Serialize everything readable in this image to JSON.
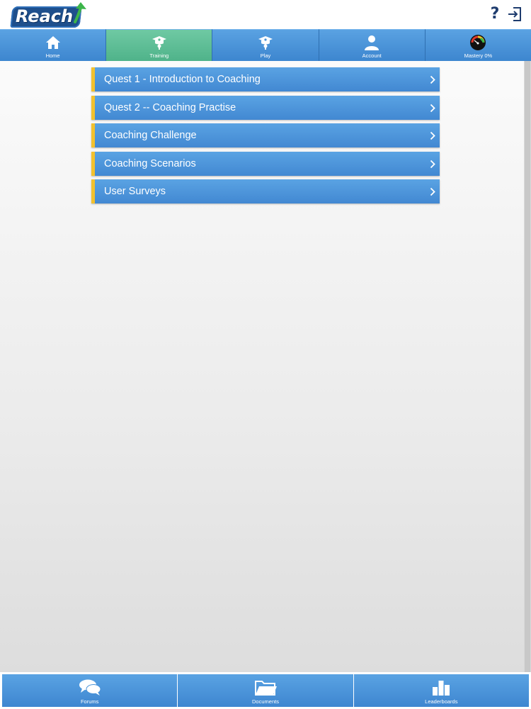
{
  "app": {
    "logo_text": "Reach"
  },
  "header": {
    "help_glyph": "?",
    "help_icon": "question-mark-icon",
    "logout_icon": "logout-icon"
  },
  "topnav": {
    "items": [
      {
        "label": "Home",
        "icon": "home-icon",
        "active": false
      },
      {
        "label": "Training",
        "icon": "graduation-icon",
        "active": true
      },
      {
        "label": "Play",
        "icon": "graduation-icon",
        "active": false
      },
      {
        "label": "Account",
        "icon": "user-icon",
        "active": false
      },
      {
        "label": "Mastery 0%",
        "icon": "gauge-icon",
        "active": false
      }
    ]
  },
  "menu": {
    "items": [
      {
        "label": "Quest 1 - Introduction to Coaching"
      },
      {
        "label": "Quest 2 -- Coaching Practise"
      },
      {
        "label": "Coaching Challenge"
      },
      {
        "label": "Coaching Scenarios"
      },
      {
        "label": "User Surveys"
      }
    ]
  },
  "bottomnav": {
    "items": [
      {
        "label": "Forums",
        "icon": "chat-bubbles-icon"
      },
      {
        "label": "Documents",
        "icon": "folder-icon"
      },
      {
        "label": "Leaderboards",
        "icon": "bar-chart-icon"
      }
    ]
  },
  "colors": {
    "nav_blue": "#4a93d8",
    "nav_active_green": "#5cbd94",
    "menu_accent_yellow": "#f2c12e",
    "logo_navy": "#1e4f8c"
  }
}
